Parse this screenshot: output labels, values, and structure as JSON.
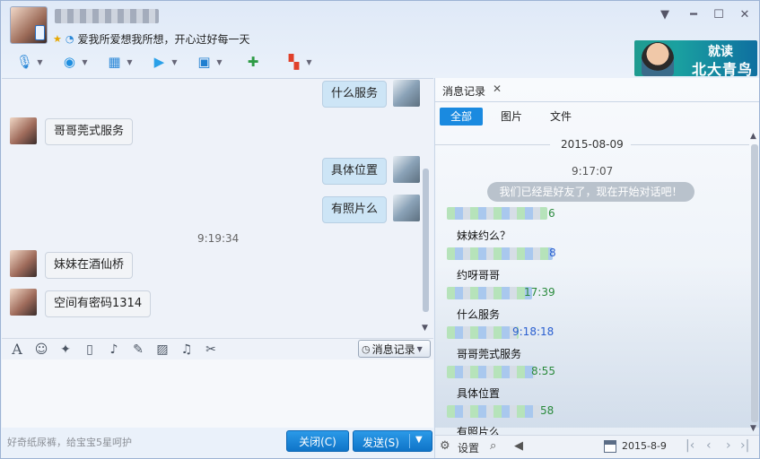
{
  "header": {
    "signature": "爱我所爱想我所想，开心过好每一天"
  },
  "ad": {
    "line1": "就读",
    "line2": "北大青鸟"
  },
  "chat": {
    "messages": [
      {
        "text": "什么服务",
        "side": "out"
      },
      {
        "text": "哥哥莞式服务",
        "side": "in"
      },
      {
        "text": "具体位置",
        "side": "out"
      },
      {
        "text": "有照片么",
        "side": "out"
      },
      {
        "text": "妹妹在酒仙桥",
        "side": "in"
      },
      {
        "text": "空间有密码1314",
        "side": "in"
      }
    ],
    "timestamp": "9:19:34"
  },
  "input_toolbar": {
    "history_label": "消息记录"
  },
  "footer": {
    "tip": "好奇纸尿裤，给宝宝5星呵护",
    "close_label": "关闭(C)",
    "send_label": "发送(S)"
  },
  "history": {
    "tab_label": "消息记录",
    "filters": [
      "全部",
      "图片",
      "文件"
    ],
    "date": "2015-08-09",
    "time": "9:17:07",
    "system_message": "我们已经是好友了，现在开始对话吧！",
    "entries": [
      {
        "time_fragment": "6",
        "text": "妹妹约么？"
      },
      {
        "time_fragment": "8",
        "text": "约呀哥哥"
      },
      {
        "time_fragment": "17:39",
        "text": "什么服务"
      },
      {
        "time_fragment": "9:18:18",
        "text": "哥哥莞式服务"
      },
      {
        "time_fragment": "8:55",
        "text": "具体位置"
      },
      {
        "time_fragment": "58",
        "text": "有照片么"
      }
    ],
    "settings_label": "设置",
    "bottom_date": "2015-8-9"
  },
  "colors": {
    "accent": "#1a8ae0",
    "out_bubble": "#cde5f6",
    "history_time_green": "#2a8a3c"
  }
}
